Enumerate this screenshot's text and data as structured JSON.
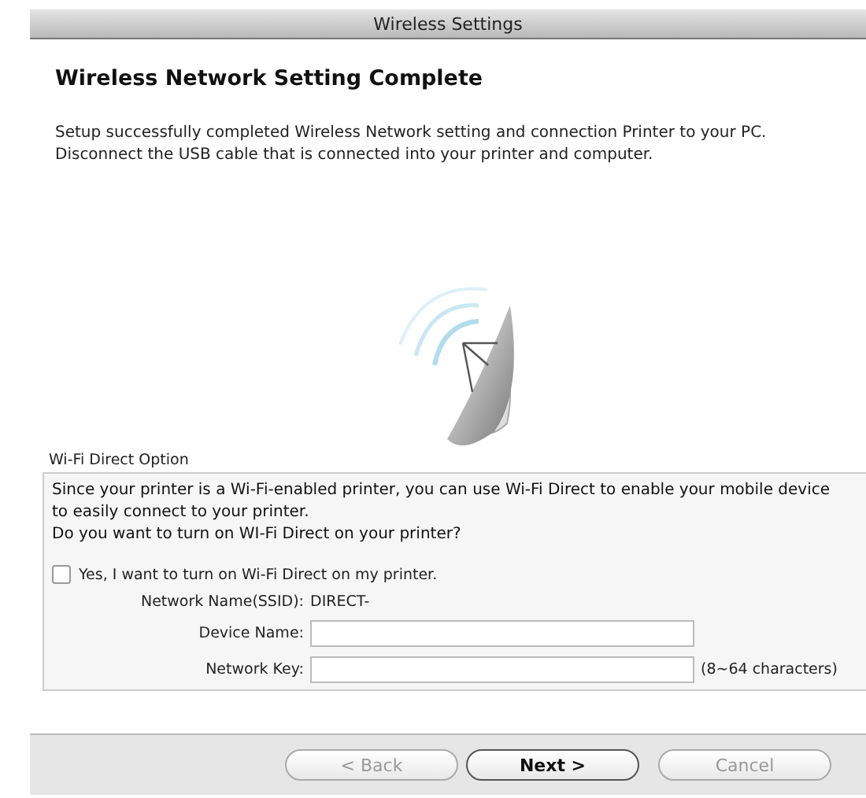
{
  "window": {
    "title": "Wireless Settings"
  },
  "heading": "Wireless Network Setting Complete",
  "description": [
    "Setup successfully completed Wireless Network setting and connection Printer to your PC.",
    "Disconnect the USB cable that is connected into your printer and computer."
  ],
  "wifi_direct": {
    "group_label": "Wi-Fi Direct Option",
    "info": [
      "Since your printer is a Wi-Fi-enabled printer, you can use Wi-Fi Direct to enable your mobile device to easily connect to your printer.",
      "Do you want to turn on WI-Fi Direct on your printer?"
    ],
    "checkbox": {
      "label": "Yes, I want to turn on Wi-Fi Direct on my printer.",
      "checked": false
    },
    "ssid": {
      "label": "Network Name(SSID):",
      "value": "DIRECT-"
    },
    "fields": [
      {
        "label": "Device Name:"
      },
      {
        "label": "Network Key:",
        "hint": "(8~64 characters)"
      }
    ]
  },
  "buttons": [
    {
      "label": "< Back",
      "disabled": true,
      "default": false
    },
    {
      "label": "Next >",
      "disabled": false,
      "default": true
    },
    {
      "label": "Cancel",
      "disabled": true,
      "default": false
    }
  ]
}
